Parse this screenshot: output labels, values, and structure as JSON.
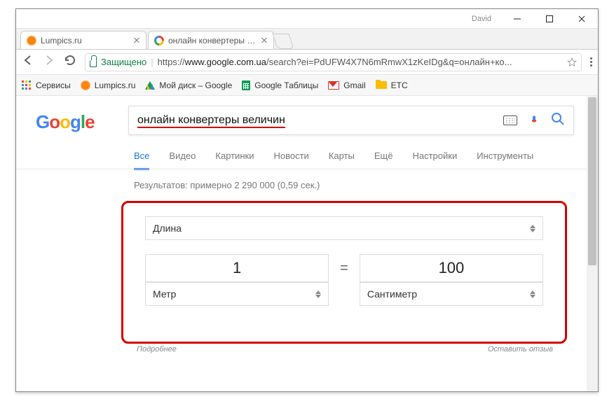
{
  "caption": {
    "user": "David"
  },
  "tabs": [
    {
      "title": "Lumpics.ru"
    },
    {
      "title": "онлайн конвертеры вел"
    }
  ],
  "address": {
    "secure_label": "Защищено",
    "url_prefix": "https://",
    "url_domain": "www.google.com.ua",
    "url_path": "/search?ei=PdUFW4X7N6mRmwX1zKeIDg&q=онлайн+ко..."
  },
  "bookmarks": {
    "apps": "Сервисы",
    "items": [
      "Lumpics.ru",
      "Мой диск – Google",
      "Google Таблицы",
      "Gmail",
      "ETC"
    ]
  },
  "search": {
    "query": "онлайн конвертеры величин",
    "nav": [
      "Все",
      "Видео",
      "Картинки",
      "Новости",
      "Карты",
      "Ещё",
      "Настройки",
      "Инструменты"
    ],
    "stats": "Результатов: примерно 2 290 000 (0,59 сек.)"
  },
  "converter": {
    "category": "Длина",
    "from_value": "1",
    "from_unit": "Метр",
    "to_value": "100",
    "to_unit": "Сантиметр",
    "equals": "="
  },
  "footer": {
    "more": "Подробнее",
    "feedback": "Оставить отзыв"
  }
}
